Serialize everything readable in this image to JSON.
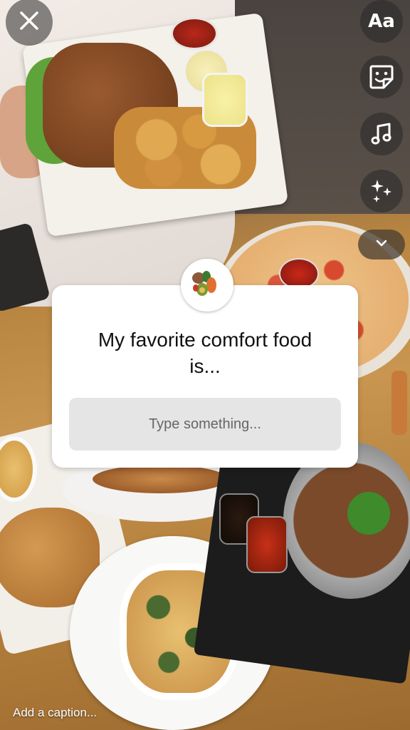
{
  "story": {
    "close_icon": "close-icon",
    "tools": [
      {
        "name": "text-tool",
        "label": "Aa"
      },
      {
        "name": "sticker-tool",
        "icon": "sticker-face-icon"
      },
      {
        "name": "music-tool",
        "icon": "music-note-icon"
      },
      {
        "name": "effects-tool",
        "icon": "sparkles-icon"
      }
    ],
    "collapse_icon": "chevron-down-icon"
  },
  "question_sticker": {
    "question_line1": "My favorite comfort food",
    "question_line2": "is...",
    "input_placeholder": "Type something...",
    "input_value": ""
  },
  "caption": {
    "placeholder": "Add a caption..."
  },
  "colors": {
    "sticker_bg": "#ffffff",
    "input_bg": "#e5e5e5",
    "table_wood": "#b9823f",
    "icon_color": "#ffffff"
  }
}
